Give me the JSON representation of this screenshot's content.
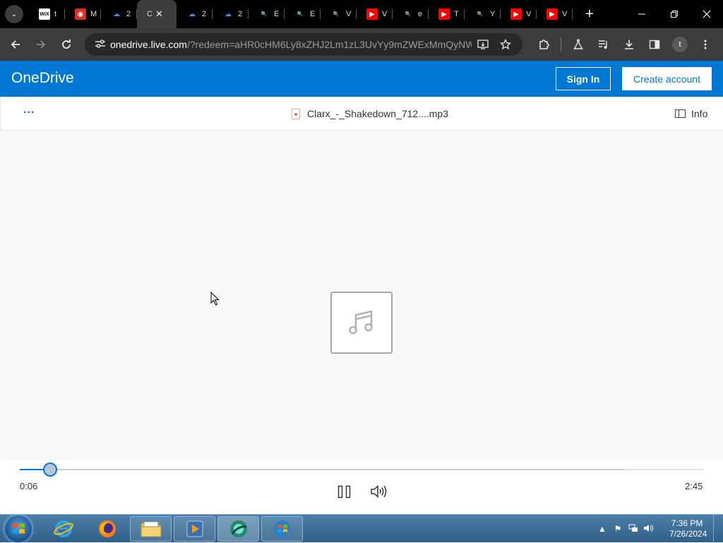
{
  "browser": {
    "tabs": [
      {
        "letter": "t",
        "icon_text": "WiX",
        "icon_bg": "#ffffff",
        "icon_fg": "#000000"
      },
      {
        "letter": "M",
        "icon_text": "◉",
        "icon_bg": "#d93025",
        "icon_fg": "#ffffff"
      },
      {
        "letter": "2",
        "icon_text": "☁",
        "icon_bg": "transparent",
        "icon_fg": "#3b8fe6"
      },
      {
        "letter": "C",
        "active": true
      },
      {
        "letter": "2",
        "icon_text": "☁",
        "icon_bg": "transparent",
        "icon_fg": "#3b8fe6"
      },
      {
        "letter": "2",
        "icon_text": "☁",
        "icon_bg": "transparent",
        "icon_fg": "#3b8fe6"
      },
      {
        "letter": "E",
        "icon_text": "🔍",
        "icon_bg": "transparent",
        "icon_fg": "#5aa0ff"
      },
      {
        "letter": "E",
        "icon_text": "🔍",
        "icon_bg": "transparent",
        "icon_fg": "#5aa0ff"
      },
      {
        "letter": "V",
        "icon_text": "🔍",
        "icon_bg": "transparent",
        "icon_fg": "#5aa0ff"
      },
      {
        "letter": "V",
        "icon_text": "▶",
        "icon_bg": "#ff0000",
        "icon_fg": "#ffffff"
      },
      {
        "letter": "e",
        "icon_text": "🔍",
        "icon_bg": "transparent",
        "icon_fg": "#5aa0ff"
      },
      {
        "letter": "T",
        "icon_text": "▶",
        "icon_bg": "#ff0000",
        "icon_fg": "#ffffff"
      },
      {
        "letter": "Y",
        "icon_text": "🔍",
        "icon_bg": "transparent",
        "icon_fg": "#5aa0ff"
      },
      {
        "letter": "V",
        "icon_text": "▶",
        "icon_bg": "#ff0000",
        "icon_fg": "#ffffff"
      },
      {
        "letter": "V",
        "icon_text": "▶",
        "icon_bg": "#ff0000",
        "icon_fg": "#ffffff"
      }
    ],
    "url_host": "onedrive.live.com",
    "url_rest": "/?redeem=aHR0cHM6Ly8xZHJ2Lm1zL3UvYy9mZWExMmQyNW...",
    "profile_initial": "t"
  },
  "onedrive": {
    "brand": "OneDrive",
    "sign_in": "Sign In",
    "create_account": "Create account",
    "more_label": "...",
    "file_name": "Clarx_-_Shakedown_712....mp3",
    "info_label": "Info",
    "accent": "#0078d4"
  },
  "player": {
    "current_time": "0:06",
    "duration": "2:45",
    "progress_fraction": 0.036,
    "buffered_fraction": 0.885
  },
  "taskbar": {
    "clock_time": "7:36 PM",
    "clock_date": "7/26/2024"
  }
}
